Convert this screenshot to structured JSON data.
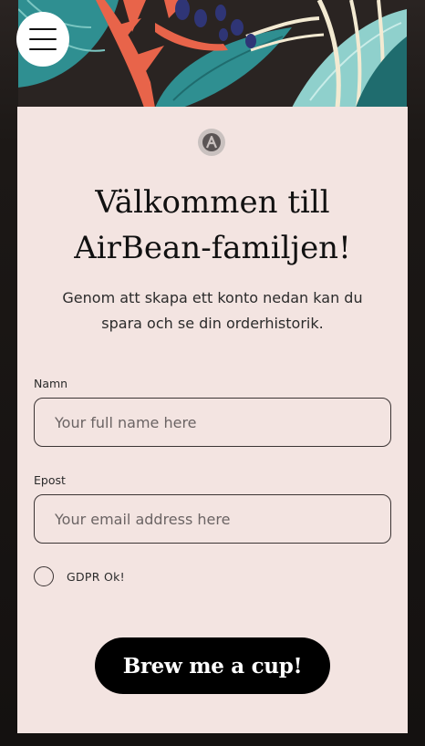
{
  "header": {
    "menu_icon": "hamburger-menu-icon"
  },
  "card": {
    "logo_icon": "airbean-logo-icon",
    "title_line1": "Välkommen till",
    "title_line2": "AirBean-familjen!",
    "intro": "Genom att skapa ett konto nedan kan du spara och se din orderhistorik."
  },
  "form": {
    "name": {
      "label": "Namn",
      "placeholder": "Your full name here",
      "value": ""
    },
    "email": {
      "label": "Epost",
      "placeholder": "Your email address here",
      "value": ""
    },
    "gdpr": {
      "label": "GDPR Ok!",
      "checked": false
    },
    "submit_label": "Brew me a cup!"
  },
  "colors": {
    "background": "#1e1a18",
    "card": "#f3e4e1",
    "button": "#000000",
    "leaf_teal": "#2f8f91",
    "leaf_coral": "#e8644a",
    "leaf_navy": "#2f3576",
    "leaf_cream": "#f3ead2"
  }
}
